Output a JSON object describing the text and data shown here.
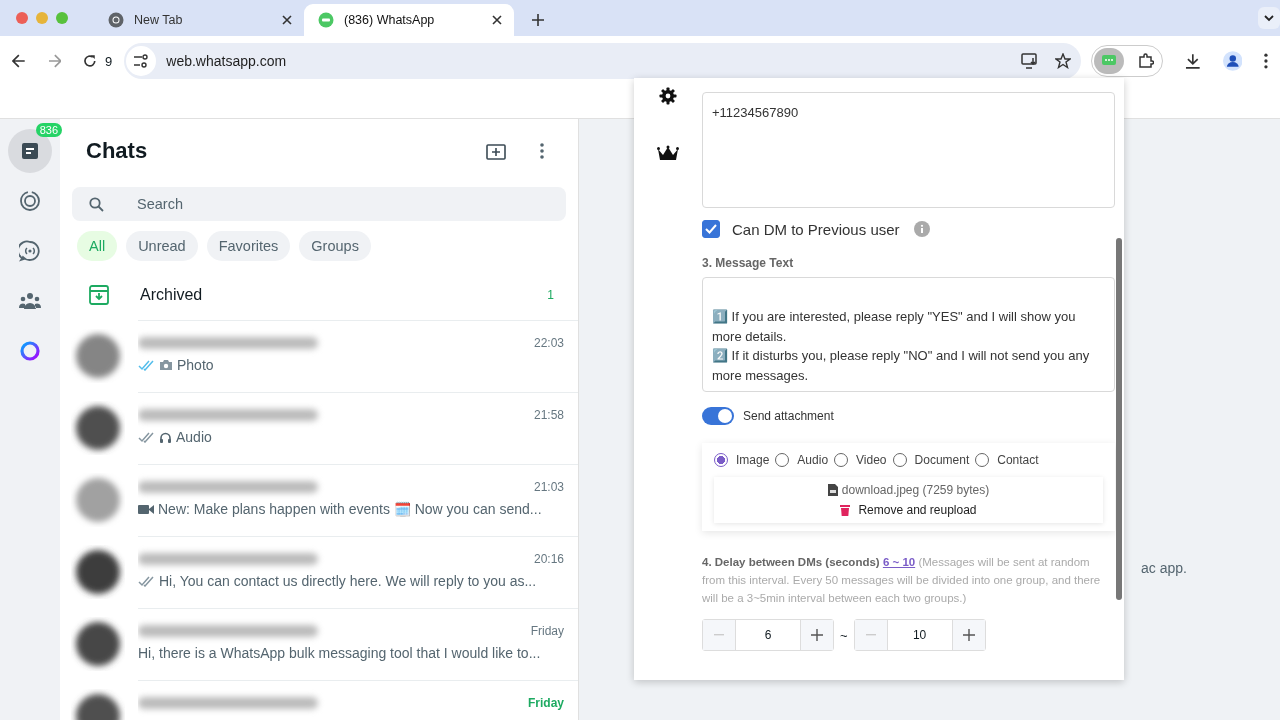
{
  "browser": {
    "tabs": [
      {
        "title": "New Tab",
        "selected": false
      },
      {
        "title": "(836) WhatsApp",
        "selected": true
      }
    ],
    "extension_count": "9",
    "url": "web.whatsapp.com"
  },
  "nav": {
    "items": [
      {
        "kind": "chats",
        "selected": true,
        "badge": "836"
      },
      {
        "kind": "status",
        "selected": false
      },
      {
        "kind": "channels",
        "selected": false
      },
      {
        "kind": "communities",
        "selected": false
      },
      {
        "kind": "ai",
        "selected": false
      }
    ]
  },
  "chat_list": {
    "title": "Chats",
    "search": {
      "placeholder": "Search"
    },
    "filters": [
      {
        "label": "All",
        "selected": true
      },
      {
        "label": "Unread",
        "selected": false
      },
      {
        "label": "Favorites",
        "selected": false
      },
      {
        "label": "Groups",
        "selected": false
      }
    ],
    "archived": {
      "label": "Archived",
      "count": "1"
    },
    "chats": [
      {
        "time": "22:03",
        "kind": "photo",
        "delivered": true,
        "read": true,
        "preview": "Photo",
        "unread": false
      },
      {
        "time": "21:58",
        "kind": "audio",
        "delivered": true,
        "read": false,
        "preview": "Audio",
        "unread": false
      },
      {
        "time": "21:03",
        "kind": "video",
        "delivered": false,
        "preview": "New: Make plans happen with events 🗓️ Now you can send...",
        "unread": false
      },
      {
        "time": "20:16",
        "kind": "text",
        "delivered": true,
        "read": false,
        "preview": "Hi,   You can contact us directly here. We will reply to you as...",
        "unread": false
      },
      {
        "time": "Friday",
        "kind": "text",
        "delivered": false,
        "preview": "Hi, there is a WhatsApp bulk messaging tool that I would like to...",
        "unread": false
      },
      {
        "time": "Friday",
        "unread": true
      }
    ]
  },
  "background_text": "ac app.",
  "panel": {
    "numbers": {
      "value": "+11234567890"
    },
    "dm_previous": {
      "label": "Can DM to Previous user",
      "checked": true
    },
    "message": {
      "label": "3. Message Text",
      "value": "1️⃣ If you are interested, please reply \"YES\" and I will show you more details.\n2️⃣ If it disturbs you, please reply \"NO\" and I will not send you any more messages."
    },
    "attachment": {
      "label": "Send attachment",
      "on": true,
      "types": [
        {
          "label": "Image",
          "selected": true
        },
        {
          "label": "Audio",
          "selected": false
        },
        {
          "label": "Video",
          "selected": false
        },
        {
          "label": "Document",
          "selected": false
        },
        {
          "label": "Contact",
          "selected": false
        }
      ],
      "file": "download.jpeg (7259 bytes)",
      "remove": "Remove and reupload"
    },
    "delay": {
      "label": "4. Delay between DMs (seconds)",
      "range": "6 ~ 10",
      "note": "(Messages will be sent at random from this interval. Every 50 messages will be divided into one group, and there will be a 3~5min interval between each two groups.)",
      "min": {
        "value": "6",
        "minus_disabled": true
      },
      "separator": "~",
      "max": {
        "value": "10",
        "minus_disabled": true
      }
    }
  }
}
